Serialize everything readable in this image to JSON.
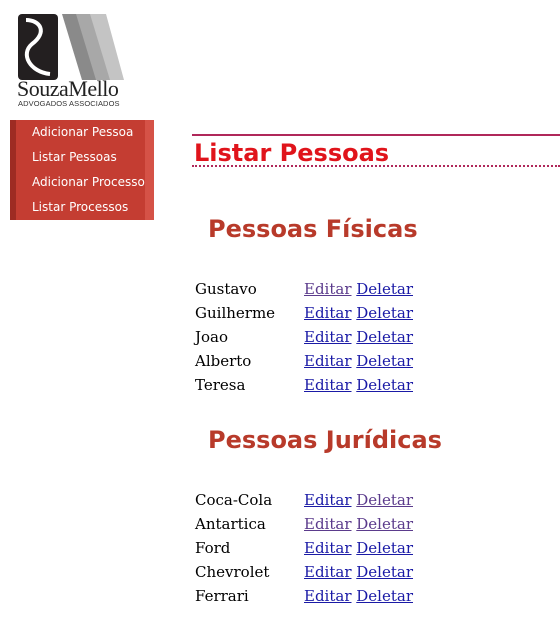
{
  "logo": {
    "name": "SouzaMello",
    "subtitle": "ADVOGADOS ASSOCIADOS"
  },
  "menu": [
    {
      "label": "Adicionar Pessoa"
    },
    {
      "label": "Listar Pessoas"
    },
    {
      "label": "Adicionar Processo"
    },
    {
      "label": "Listar Processos"
    }
  ],
  "page_title": "Listar Pessoas",
  "colors": {
    "menu_bg": "#c43d32",
    "title": "#e0141b",
    "section": "#b83a2a",
    "rule": "#b0285a",
    "link": "#1a1aa6",
    "visited": "#5b3b8c"
  },
  "fisicas": {
    "title": "Pessoas Físicas",
    "rows": [
      {
        "name": "Gustavo",
        "edit": "Editar",
        "delete": "Deletar",
        "edit_visited": true,
        "delete_visited": false
      },
      {
        "name": "Guilherme",
        "edit": "Editar",
        "delete": "Deletar",
        "edit_visited": false,
        "delete_visited": false
      },
      {
        "name": "Joao",
        "edit": "Editar",
        "delete": "Deletar",
        "edit_visited": false,
        "delete_visited": false
      },
      {
        "name": "Alberto",
        "edit": "Editar",
        "delete": "Deletar",
        "edit_visited": false,
        "delete_visited": false
      },
      {
        "name": "Teresa",
        "edit": "Editar",
        "delete": "Deletar",
        "edit_visited": false,
        "delete_visited": false
      }
    ]
  },
  "juridicas": {
    "title": "Pessoas Jurídicas",
    "rows": [
      {
        "name": "Coca-Cola",
        "edit": "Editar",
        "delete": "Deletar",
        "edit_visited": false,
        "delete_visited": true
      },
      {
        "name": "Antartica",
        "edit": "Editar",
        "delete": "Deletar",
        "edit_visited": true,
        "delete_visited": true
      },
      {
        "name": "Ford",
        "edit": "Editar",
        "delete": "Deletar",
        "edit_visited": false,
        "delete_visited": false
      },
      {
        "name": "Chevrolet",
        "edit": "Editar",
        "delete": "Deletar",
        "edit_visited": false,
        "delete_visited": false
      },
      {
        "name": "Ferrari",
        "edit": "Editar",
        "delete": "Deletar",
        "edit_visited": false,
        "delete_visited": false
      }
    ]
  }
}
